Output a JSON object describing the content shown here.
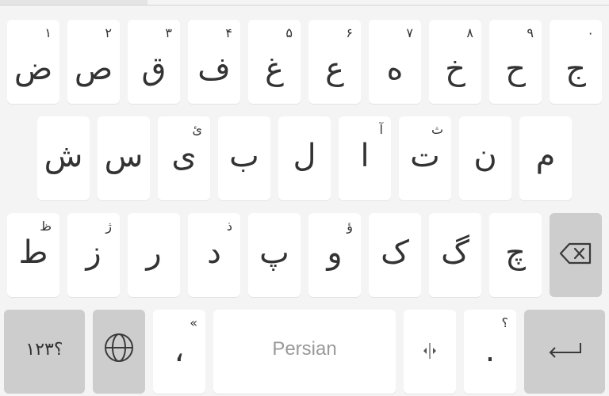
{
  "keyboard": {
    "row1": [
      {
        "char": "ض",
        "hint": "۱"
      },
      {
        "char": "ص",
        "hint": "۲"
      },
      {
        "char": "ق",
        "hint": "۳"
      },
      {
        "char": "ف",
        "hint": "۴"
      },
      {
        "char": "غ",
        "hint": "۵"
      },
      {
        "char": "ع",
        "hint": "۶"
      },
      {
        "char": "ه",
        "hint": "۷"
      },
      {
        "char": "خ",
        "hint": "۸"
      },
      {
        "char": "ح",
        "hint": "۹"
      },
      {
        "char": "ج",
        "hint": "۰"
      }
    ],
    "row2": [
      {
        "char": "ش",
        "hint": ""
      },
      {
        "char": "س",
        "hint": ""
      },
      {
        "char": "ی",
        "hint": "ئ"
      },
      {
        "char": "ب",
        "hint": ""
      },
      {
        "char": "ل",
        "hint": ""
      },
      {
        "char": "ا",
        "hint": "آ"
      },
      {
        "char": "ت",
        "hint": "ث"
      },
      {
        "char": "ن",
        "hint": ""
      },
      {
        "char": "م",
        "hint": ""
      }
    ],
    "row3": [
      {
        "char": "ط",
        "hint": "ظ"
      },
      {
        "char": "ز",
        "hint": "ژ"
      },
      {
        "char": "ر",
        "hint": ""
      },
      {
        "char": "د",
        "hint": "ذ"
      },
      {
        "char": "پ",
        "hint": ""
      },
      {
        "char": "و",
        "hint": "ؤ"
      },
      {
        "char": "ک",
        "hint": ""
      },
      {
        "char": "گ",
        "hint": ""
      },
      {
        "char": "چ",
        "hint": ""
      }
    ],
    "row4": {
      "symbols_label": "؟۱۲۳",
      "comma": {
        "char": "،",
        "hint": "«"
      },
      "space_label": "Persian",
      "period": {
        "char": ".",
        "hint": "؟"
      }
    },
    "icons": {
      "backspace": "backspace-icon",
      "globe": "globe-icon",
      "cursor": "cursor-move-icon",
      "enter": "enter-icon"
    },
    "colors": {
      "background": "#f4f4f4",
      "key": "#ffffff",
      "special_key": "#cdcdcd",
      "text": "#333333",
      "placeholder": "#9a9a9a"
    }
  }
}
